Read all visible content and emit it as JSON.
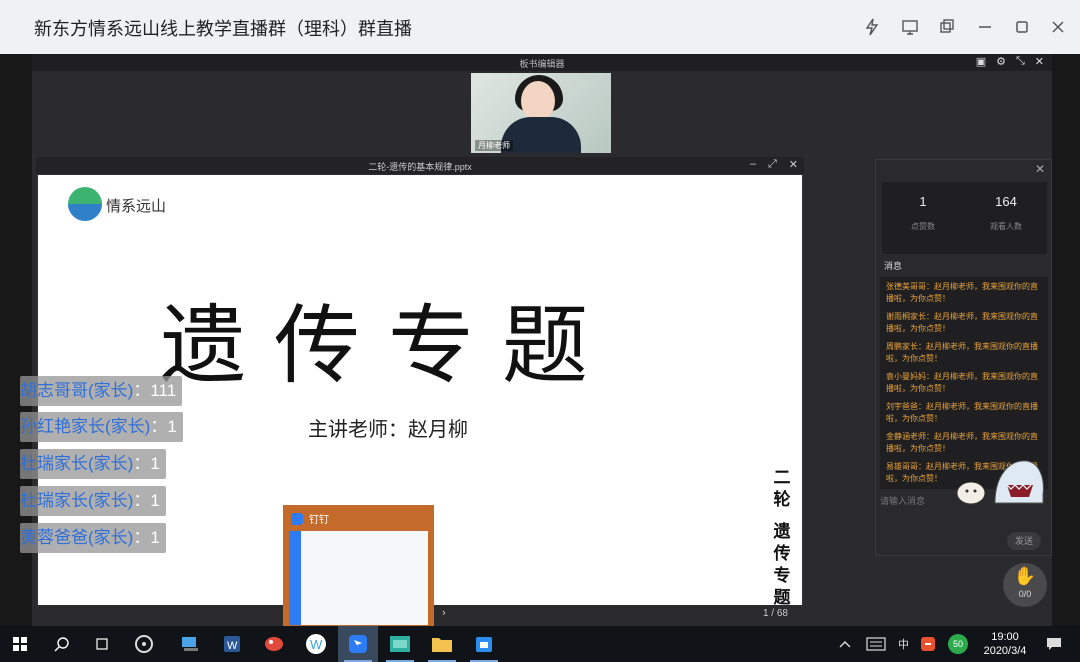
{
  "window": {
    "title": "新东方情系远山线上教学直播群（理科）群直播"
  },
  "editor": {
    "title": "板书编辑器"
  },
  "camera": {
    "label": "月柳老师"
  },
  "slide_window": {
    "filename": "二轮-遗传的基本规律.pptx",
    "page": "1 / 68"
  },
  "slide": {
    "logo_text": "情系远山",
    "title": "遗传专题",
    "presenter": "主讲老师：赵月柳",
    "vertical_1": [
      "二",
      "轮"
    ],
    "vertical_2": [
      "遗",
      "传",
      "专",
      "题"
    ]
  },
  "chat": {
    "likes": "1",
    "likes_label": "点赞数",
    "viewers": "164",
    "viewers_label": "观看人数",
    "messages_title": "消息",
    "messages": [
      "张德美哥哥：赵月柳老师，我来围观你的直播啦，为你点赞！",
      "谢雨桐家长：赵月柳老师，我来围观你的直播啦，为你点赞！",
      "周鹏家长：赵月柳老师，我来围观你的直播啦，为你点赞！",
      "袁小曼妈妈：赵月柳老师，我来围观你的直播啦，为你点赞！",
      "刘宇爸爸：赵月柳老师，我来围观你的直播啦，为你点赞！",
      "金静涵老师：赵月柳老师，我来围观你的直播啦，为你点赞！",
      "易雄哥哥：赵月柳老师，我来围观你的直播啦，为你点赞！"
    ],
    "input_placeholder": "请输入消息",
    "send_label": "发送",
    "hand_count": "0/0"
  },
  "danmaku": [
    {
      "name": "胡志哥哥(家长)",
      "value": "：111"
    },
    {
      "name": "孙红艳家长(家长)",
      "value": "：1"
    },
    {
      "name": "杜瑞家长(家长)",
      "value": "：1"
    },
    {
      "name": "杜瑞家长(家长)",
      "value": "：1"
    },
    {
      "name": "黄蓉爸爸(家长)",
      "value": "：1"
    }
  ],
  "preview": {
    "app_name": "钉钉"
  },
  "taskbar": {
    "ime": "中",
    "badge": "50",
    "time": "19:00",
    "date": "2020/3/4"
  },
  "colors": {
    "accent": "#2f6fd9",
    "message": "#e8a23c",
    "preview": "#c46a2a"
  }
}
